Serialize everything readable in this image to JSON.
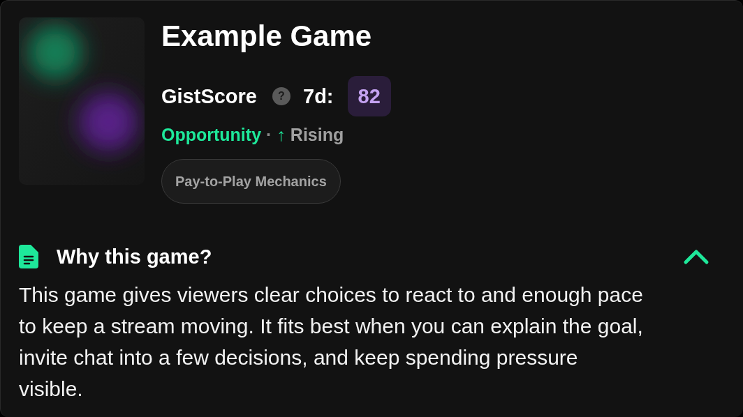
{
  "game": {
    "title": "Example Game",
    "score": {
      "label": "GistScore",
      "help": "?",
      "period": "7d:",
      "value": "82"
    },
    "status": {
      "label": "Opportunity",
      "separator": "·",
      "trend": {
        "kind": "up",
        "arrow": "↑",
        "label": "Rising"
      }
    },
    "tags": [
      {
        "label": "Pay-to-Play Mechanics"
      }
    ]
  },
  "section": {
    "title": "Why this game?",
    "expanded": true,
    "text": "This game gives viewers clear choices to react to and enough pace to keep a stream moving. It fits best when you can explain the goal, invite chat into a few decisions, and keep spending pressure visible."
  }
}
